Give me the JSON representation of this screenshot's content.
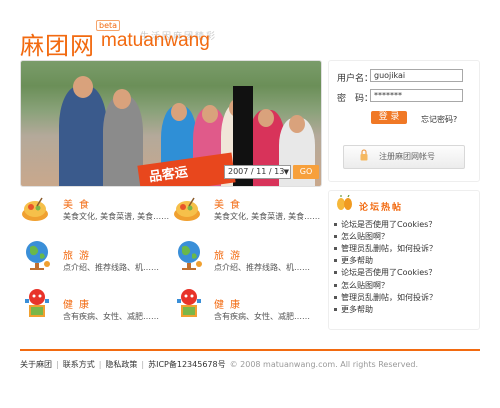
{
  "header": {
    "logo_cn": "麻团网",
    "logo_en": "matuanwang",
    "beta": "beta",
    "slogan": "生活因麻团精彩"
  },
  "photo": {
    "banner_text": "品客运",
    "date_value": "2007 / 11 / 13",
    "go_label": "GO"
  },
  "login": {
    "username_label": "用户名：",
    "username_value": "guojikai",
    "password_label": "密　码：",
    "password_value": "*******",
    "login_button": "登 录",
    "forgot_link": "忘记密码?",
    "register_button": "注册麻团网帐号"
  },
  "categories": [
    {
      "title": "美食",
      "desc": "美食文化, 美食菜谱, 美食……",
      "icon": "food-icon"
    },
    {
      "title": "美食",
      "desc": "美食文化, 美食菜谱, 美食……",
      "icon": "food-icon"
    },
    {
      "title": "旅游",
      "desc": "点介绍、推荐线路、机……",
      "icon": "globe-icon"
    },
    {
      "title": "旅游",
      "desc": "点介绍、推荐线路、机……",
      "icon": "globe-icon"
    },
    {
      "title": "健康",
      "desc": "含有疾病、女性、减肥……",
      "icon": "health-icon"
    },
    {
      "title": "健康",
      "desc": "含有疾病、女性、减肥……",
      "icon": "health-icon"
    }
  ],
  "forum": {
    "title": "论坛热帖",
    "items": [
      "论坛是否使用了Cookies？",
      "怎么贴图啊？",
      "管理员乱删帖，如何投诉？",
      "更多帮助",
      "论坛是否使用了Cookies？",
      "怎么贴图啊？",
      "管理员乱删帖，如何投诉？",
      "更多帮助"
    ]
  },
  "footer": {
    "links": [
      "关于麻团",
      "联系方式",
      "隐私政策",
      "苏ICP备12345678号"
    ],
    "copyright": "© 2008 matuanwang.com. All rights Reserved."
  },
  "colors": {
    "accent": "#f26a10",
    "button": "#f07825"
  }
}
